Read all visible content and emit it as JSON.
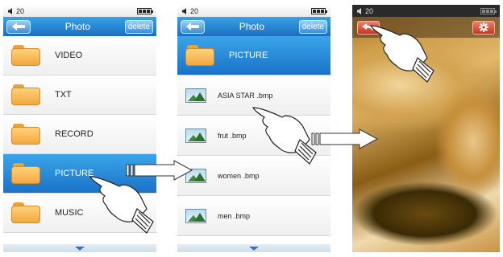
{
  "status": {
    "volume_level": "20"
  },
  "screen1": {
    "title": "Photo",
    "delete_label": "delete",
    "items": [
      {
        "label": "VIDEO",
        "selected": false
      },
      {
        "label": "TXT",
        "selected": false
      },
      {
        "label": "RECORD",
        "selected": false
      },
      {
        "label": "PICTURE",
        "selected": true
      },
      {
        "label": "MUSIC",
        "selected": false
      }
    ]
  },
  "screen2": {
    "title": "Photo",
    "delete_label": "delete",
    "folder_header": "PICTURE",
    "files": [
      {
        "label": "ASIA STAR .bmp"
      },
      {
        "label": "frut .bmp"
      },
      {
        "label": "women .bmp"
      },
      {
        "label": "men .bmp"
      }
    ]
  },
  "screen3": {
    "back_icon": "return-arrow-icon",
    "settings_icon": "gear-icon"
  },
  "colors": {
    "accent_blue": "#1a72c7",
    "folder_orange": "#f2a83e",
    "red_button": "#c8341c"
  }
}
